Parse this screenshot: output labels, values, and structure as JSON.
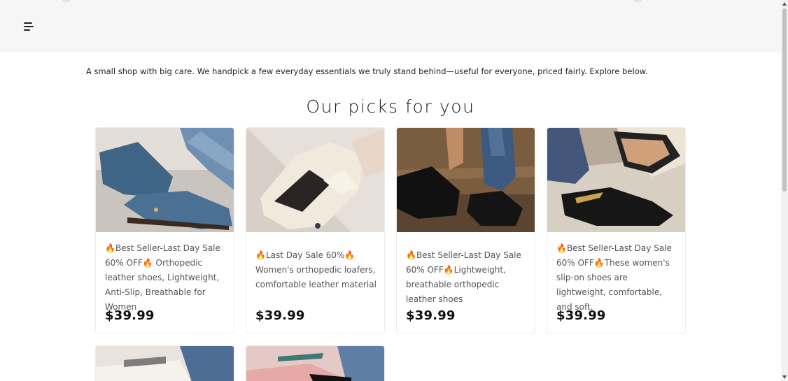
{
  "header": {
    "menu_icon": "hamburger-menu-icon"
  },
  "intro_text": "A small shop with big care. We handpick a few everyday essentials we truly stand behind—useful for everyone, priced fairly. Explore below.",
  "section_title": "Our picks for you",
  "products": [
    {
      "title": "🔥Best Seller-Last Day Sale 60% OFF🔥 Orthopedic leather shoes, Lightweight, Anti-Slip, Breathable for Women",
      "price": "$39.99"
    },
    {
      "title": "🔥Last Day Sale 60%🔥Women's orthopedic loafers, comfortable leather material",
      "price": "$39.99"
    },
    {
      "title": "🔥Best Seller-Last Day Sale 60% OFF🔥Lightweight, breathable orthopedic leather shoes",
      "price": "$39.99"
    },
    {
      "title": "🔥Best Seller-Last Day Sale 60% OFF🔥These women's slip-on shoes are lightweight, comfortable, and soft.",
      "price": "$39.99"
    }
  ],
  "colors": {
    "header_bg": "#f7f6f6",
    "page_bg": "#ffffff",
    "price": "#111111",
    "title": "#555555"
  }
}
